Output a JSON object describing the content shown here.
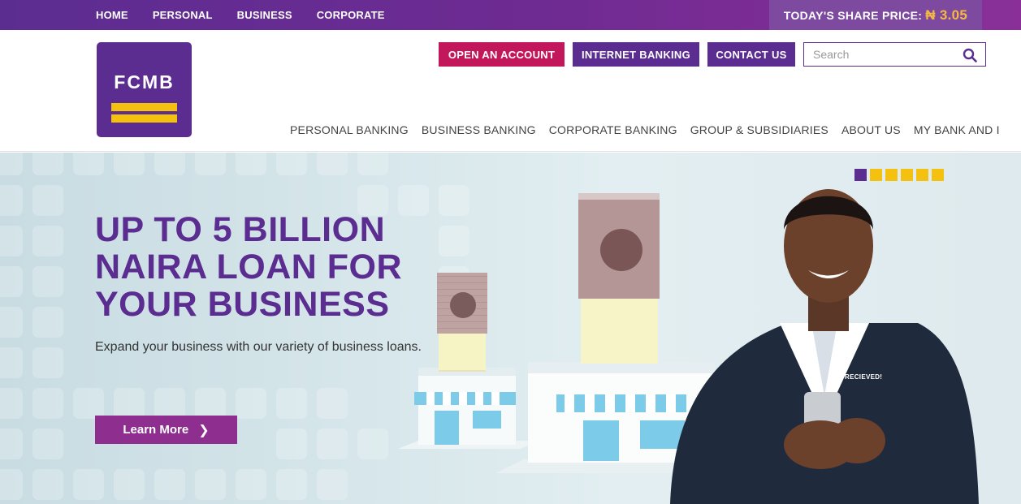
{
  "topnav": {
    "items": [
      "HOME",
      "PERSONAL",
      "BUSINESS",
      "CORPORATE"
    ]
  },
  "share": {
    "label": "TODAY'S SHARE PRICE:",
    "price": "₦ 3.05"
  },
  "logo": {
    "text": "FCMB"
  },
  "actions": {
    "open_account": "OPEN AN ACCOUNT",
    "internet_banking": "INTERNET BANKING",
    "contact_us": "CONTACT US"
  },
  "search": {
    "placeholder": "Search",
    "icon": "search-icon"
  },
  "mainnav": {
    "items": [
      "PERSONAL BANKING",
      "BUSINESS BANKING",
      "CORPORATE BANKING",
      "GROUP & SUBSIDIARIES",
      "ABOUT US",
      "MY BANK AND I"
    ]
  },
  "hero": {
    "headline": [
      "UP TO 5 BILLION",
      "NAIRA LOAN FOR",
      "YOUR BUSINESS"
    ],
    "subtext": "Expand your business with our variety of business loans.",
    "cta": "Learn More",
    "cta_icon": "chevron-right-icon",
    "phone_label": "RECIEVED!",
    "slides": 6,
    "active_slide": 1
  },
  "colors": {
    "brand_purple": "#5c2d91",
    "brand_yellow": "#f4c10f",
    "accent_pink": "#c2185b",
    "cta_magenta": "#8e2f8f",
    "price_orange": "#f5b942"
  }
}
